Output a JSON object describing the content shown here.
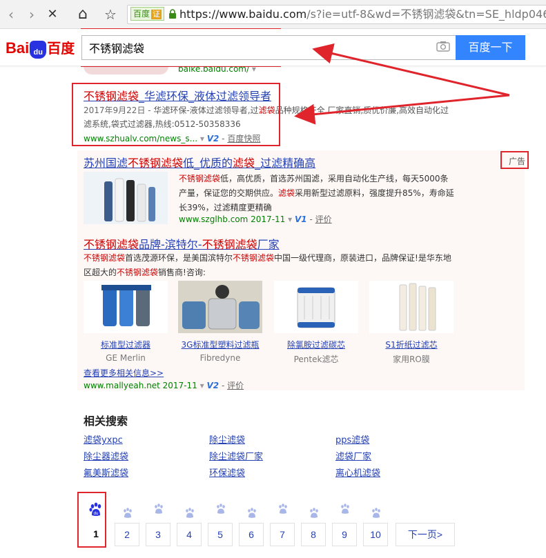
{
  "browser": {
    "back_glyph": "‹",
    "forward_glyph": "›",
    "stop_glyph": "✕",
    "home_glyph": "⌂",
    "star_glyph": "☆",
    "security_label": "百度",
    "security_badge": "证",
    "url_host": "https://www.baidu.com",
    "url_rest": "/s?ie=utf-8&wd=不锈钢滤袋&tn=SE_hldp04680_p"
  },
  "header": {
    "logo_bai": "Bai",
    "logo_du": "du",
    "logo_cn": "百度",
    "search_value": "不锈钢滤袋",
    "search_button": "百度一下"
  },
  "previous_result": {
    "url": "baike.baidu.com/"
  },
  "result1": {
    "title": {
      "em1": "不锈钢滤袋",
      "rest": "_华滤环保_液体过滤领导者"
    },
    "abstract": {
      "date": "2017年9月22日 - ",
      "t1": "华滤环保-液体过滤领导者,过",
      "em": "滤袋",
      "t2": "品种规格齐全,厂家直销,质优价廉,高效自动化过滤系统,袋式过滤器,热线:0512-50358336"
    },
    "url": "www.szhualv.com/news_s...",
    "v": "V2",
    "snapshot": "百度快照"
  },
  "ad1": {
    "tag": "广告",
    "title": {
      "t1": "苏州国滤",
      "em1": "不锈钢滤袋",
      "t2": "低_优质的",
      "em2": "滤袋",
      "t3": "_过滤精确高"
    },
    "abstract": {
      "em1": "不锈钢滤袋",
      "t1": "低，高优质，首选苏州国滤，采用自动化生产线，每天5000条产量，保证您的交期供应。",
      "em2": "滤袋",
      "t2": "采用新型过滤原料，强度提升85%，寿命延长39%，过滤精度更精确"
    },
    "url": "www.szglhb.com",
    "date": "2017-11",
    "v": "V1",
    "review": "评价"
  },
  "ad2": {
    "title": {
      "em1": "不锈钢滤袋",
      "t1": "品牌-滨特尔-",
      "em2": "不锈钢滤袋",
      "t2": "厂家"
    },
    "abstract": {
      "em1": "不锈钢滤袋",
      "t1": "首选茂源环保，是美国滨特尔",
      "em2": "不锈钢滤袋",
      "t2": "中国一级代理商，原装进口，品牌保证!是华东地区超大的",
      "em3": "不锈钢滤袋",
      "t3": "销售商!咨询:"
    },
    "products": [
      {
        "name": "标准型过滤器",
        "sub": "GE Merlin"
      },
      {
        "name": "3G标准型塑料过滤瓶",
        "sub": "Fibredyne"
      },
      {
        "name": "除氯胺过滤碳芯",
        "sub": "Pentek滤芯"
      },
      {
        "name": "S1折纸过滤芯",
        "sub": "家用RO膜"
      }
    ],
    "more": "查看更多相关信息>>",
    "url": "www.mallyeah.net",
    "date": "2017-11",
    "v": "V2",
    "review": "评价"
  },
  "related": {
    "title": "相关搜索",
    "items": [
      "滤袋yxpc",
      "除尘滤袋",
      "pps滤袋",
      "除尘器滤袋",
      "除尘滤袋厂家",
      "滤袋厂家",
      "氟美斯滤袋",
      "环保滤袋",
      "离心机滤袋"
    ]
  },
  "pagination": {
    "pages": [
      "1",
      "2",
      "3",
      "4",
      "5",
      "6",
      "7",
      "8",
      "9",
      "10"
    ],
    "next": "下一页>",
    "current_paw_label": "du"
  },
  "colors": {
    "annotation_red": "#e0242b",
    "link_blue": "#2440b3",
    "highlight_red": "#cc0000",
    "url_green": "#008000",
    "search_button_blue": "#3385ff"
  }
}
